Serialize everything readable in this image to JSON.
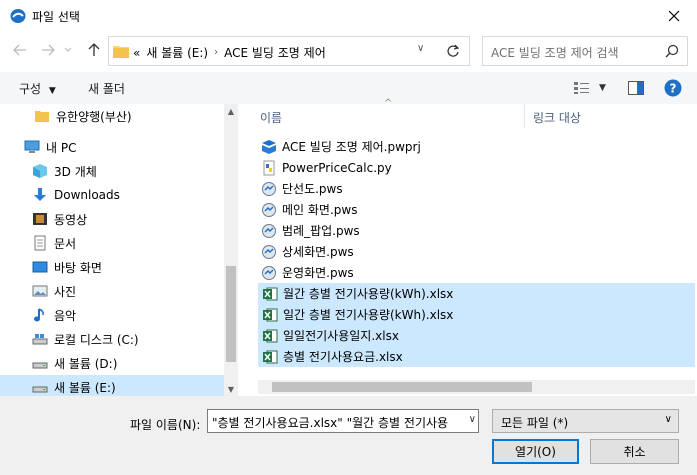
{
  "window": {
    "title": "파일 선택"
  },
  "nav": {
    "breadcrumb_prefix": "«",
    "crumbs": [
      "새 볼륨 (E:)",
      "ACE 빌딩 조명 제어"
    ],
    "search_placeholder": "ACE 빌딩 조명 제어 검색"
  },
  "toolbar": {
    "organize": "구성",
    "new_folder": "새 폴더"
  },
  "sidebar": {
    "items": [
      {
        "label": "유한양행(부산)",
        "icon": "folder-icon"
      },
      {
        "label": "내 PC",
        "icon": "pc-icon"
      },
      {
        "label": "3D 개체",
        "icon": "cube-icon"
      },
      {
        "label": "Downloads",
        "icon": "download-icon"
      },
      {
        "label": "동영상",
        "icon": "video-icon"
      },
      {
        "label": "문서",
        "icon": "document-icon"
      },
      {
        "label": "바탕 화면",
        "icon": "desktop-icon"
      },
      {
        "label": "사진",
        "icon": "picture-icon"
      },
      {
        "label": "음악",
        "icon": "music-icon"
      },
      {
        "label": "로컬 디스크 (C:)",
        "icon": "drive-icon"
      },
      {
        "label": "새 볼륨 (D:)",
        "icon": "drive-icon"
      },
      {
        "label": "새 볼륨 (E:)",
        "icon": "drive-icon"
      }
    ]
  },
  "columns": {
    "name": "이름",
    "link_target": "링크 대상"
  },
  "files": [
    {
      "name": "ACE 빌딩 조명 제어.pwprj",
      "icon": "project-icon",
      "selected": false
    },
    {
      "name": "PowerPriceCalc.py",
      "icon": "python-icon",
      "selected": false
    },
    {
      "name": "단선도.pws",
      "icon": "pws-icon",
      "selected": false
    },
    {
      "name": "메인 화면.pws",
      "icon": "pws-icon",
      "selected": false
    },
    {
      "name": "범례_팝업.pws",
      "icon": "pws-icon",
      "selected": false
    },
    {
      "name": "상세화면.pws",
      "icon": "pws-icon",
      "selected": false
    },
    {
      "name": "운영화면.pws",
      "icon": "pws-icon",
      "selected": false
    },
    {
      "name": "월간 층별 전기사용량(kWh).xlsx",
      "icon": "excel-icon",
      "selected": true
    },
    {
      "name": "일간 층별 전기사용량(kWh).xlsx",
      "icon": "excel-icon",
      "selected": true
    },
    {
      "name": "일일전기사용일지.xlsx",
      "icon": "excel-icon",
      "selected": true
    },
    {
      "name": "층별 전기사용요금.xlsx",
      "icon": "excel-icon",
      "selected": true
    }
  ],
  "bottom": {
    "filename_label": "파일 이름(N):",
    "filename_value": "\"층별 전기사용요금.xlsx\" \"월간 층별 전기사용",
    "filetype": "모든 파일  (*)",
    "open_button": "열기(O)",
    "cancel_button": "취소"
  },
  "colors": {
    "selection": "#cce8ff",
    "accent": "#0078d7"
  }
}
